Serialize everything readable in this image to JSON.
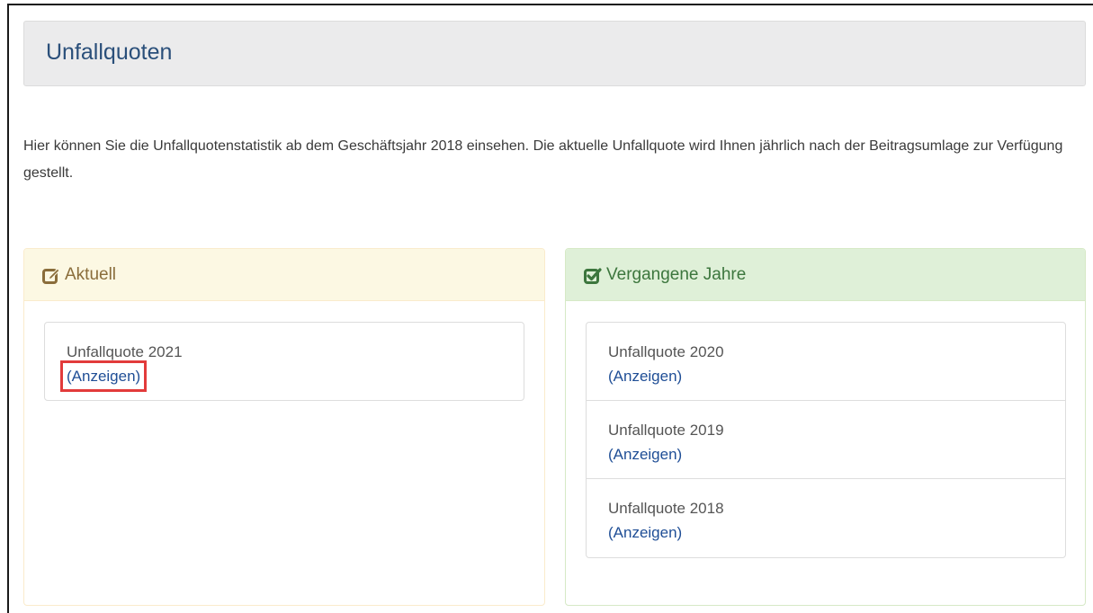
{
  "header": {
    "title": "Unfallquoten"
  },
  "intro": {
    "text": "Hier können Sie die Unfallquotenstatistik ab dem Geschäftsjahr 2018 einsehen. Die aktuelle Unfallquote wird Ihnen jährlich nach der Beitragsumlage zur Verfügung gestellt."
  },
  "current": {
    "heading": "Aktuell",
    "icon": "edit-icon",
    "color": "#8a6d3b",
    "items": [
      {
        "title": "Unfallquote 2021",
        "link": "(Anzeigen)"
      }
    ]
  },
  "past": {
    "heading": "Vergangene Jahre",
    "icon": "check-square-icon",
    "color": "#3c763d",
    "items": [
      {
        "title": "Unfallquote 2020",
        "link": "(Anzeigen)"
      },
      {
        "title": "Unfallquote 2019",
        "link": "(Anzeigen)"
      },
      {
        "title": "Unfallquote 2018",
        "link": "(Anzeigen)"
      }
    ]
  },
  "highlight_color": "#e23b3b"
}
